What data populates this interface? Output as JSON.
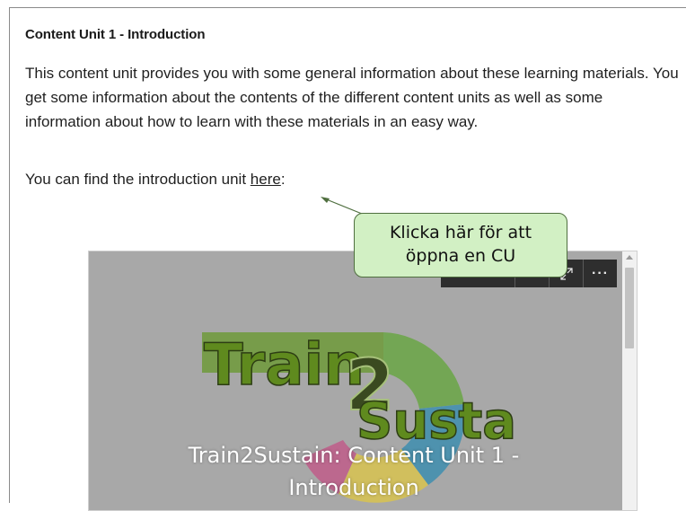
{
  "content": {
    "heading": "Content Unit 1 - Introduction",
    "paragraph": "This content unit provides you with some general information about these learning materials. You get some information about the contents of the different content units as well as some information about how to learn with these materials in an easy way.",
    "find_prefix": "You can find the introduction unit ",
    "find_link": "here",
    "find_suffix": ":"
  },
  "callout": {
    "line1": "Klicka här för att",
    "line2": "öppna en CU"
  },
  "player": {
    "toolbar_more": "···",
    "logo_text_top": "Train",
    "logo_text_2": "2",
    "logo_text_bottom": "Sustain",
    "title_line1": "Train2Sustain: Content Unit 1 -",
    "title_line2": "Introduction",
    "icons": [
      "expand-icon",
      "more-icon"
    ]
  },
  "colors": {
    "callout_bg": "#d2f0c4",
    "callout_border": "#4f6f3f",
    "player_bg": "#a8a8a8",
    "toolbar_bg": "#2e2e2e",
    "logo_green": "#5f8a1e"
  }
}
